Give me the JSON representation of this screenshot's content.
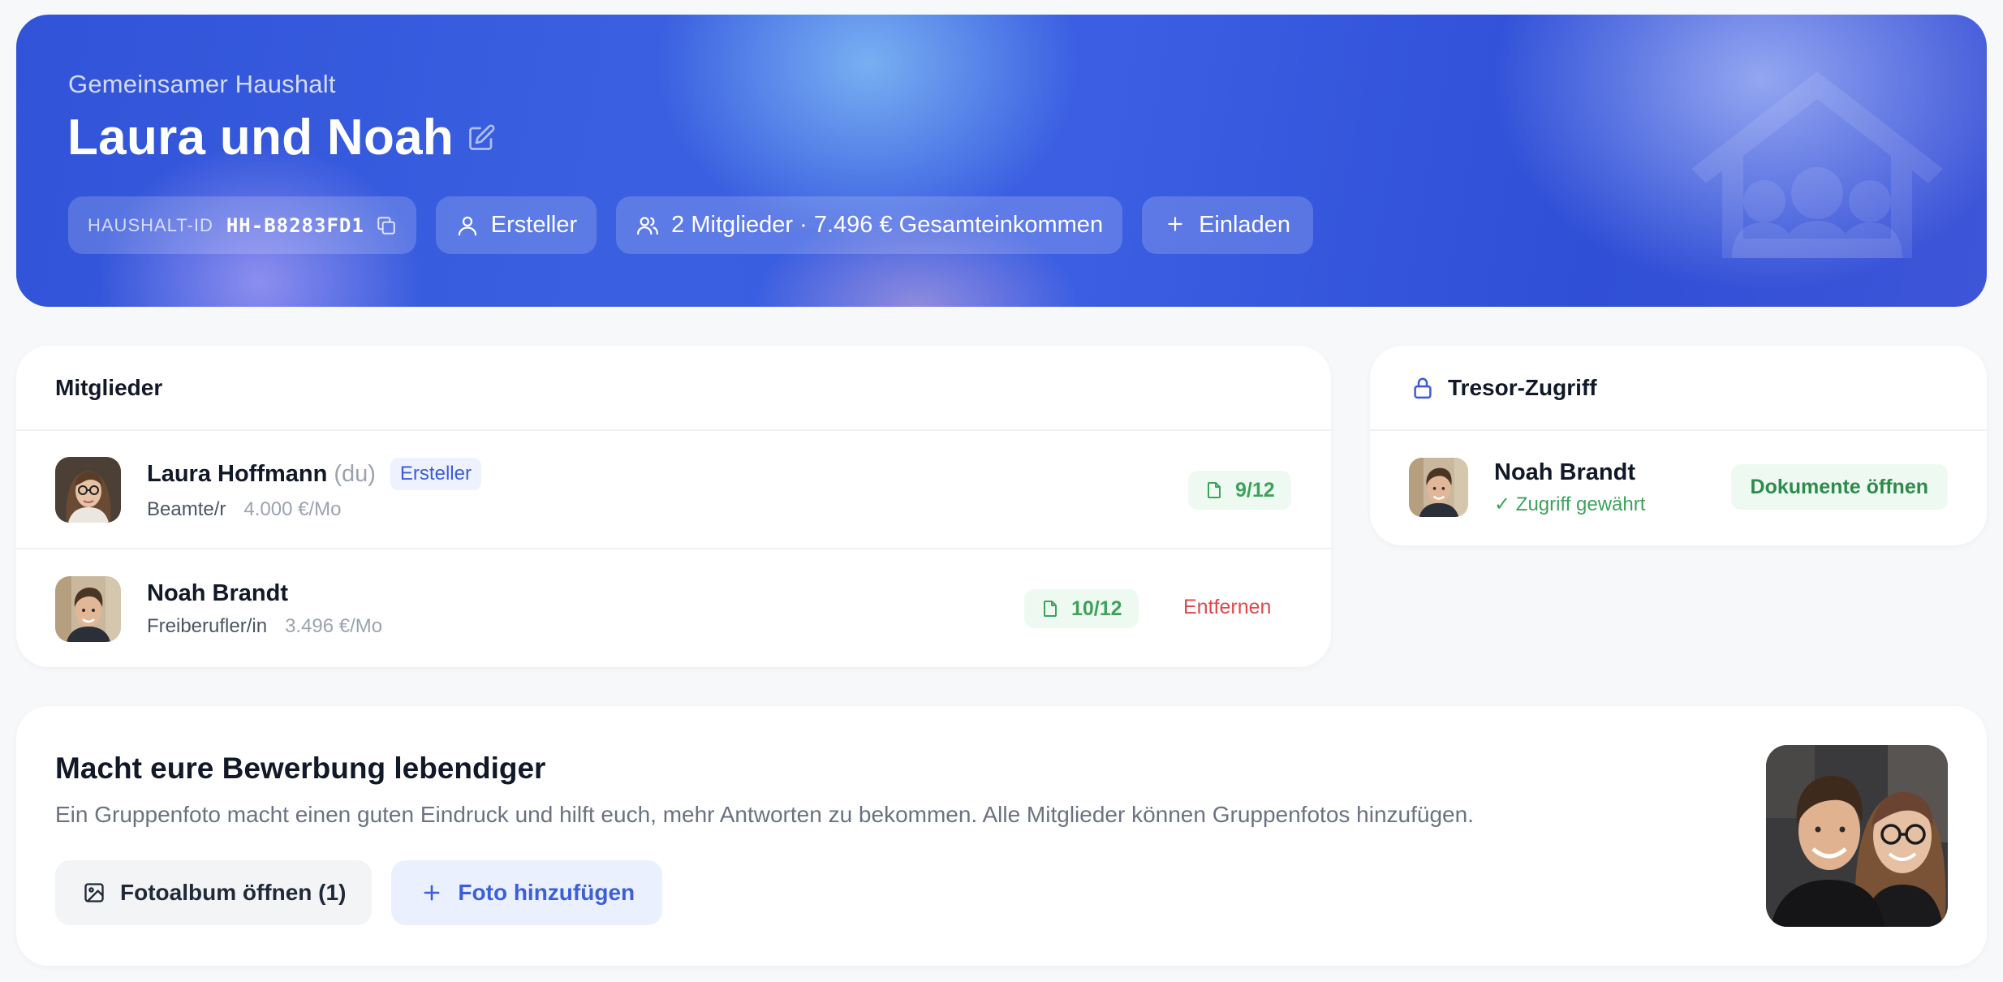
{
  "header": {
    "subtitle": "Gemeinsamer Haushalt",
    "title": "Laura und Noah",
    "household_id_label": "HAUSHALT-ID",
    "household_id": "HH-B8283FD1",
    "role": "Ersteller",
    "members_summary": "2 Mitglieder · 7.496 € Gesamteinkommen",
    "invite_label": "Einladen"
  },
  "members": {
    "heading": "Mitglieder",
    "items": [
      {
        "name": "Laura Hoffmann",
        "you_tag": "(du)",
        "badge": "Ersteller",
        "occupation": "Beamte/r",
        "income": "4.000 €/Mo",
        "documents": "9/12"
      },
      {
        "name": "Noah Brandt",
        "occupation": "Freiberufler/in",
        "income": "3.496 €/Mo",
        "documents": "10/12",
        "remove_label": "Entfernen"
      }
    ]
  },
  "vault": {
    "heading": "Tresor-Zugriff",
    "member_name": "Noah Brandt",
    "access_status": "✓ Zugriff gewährt",
    "open_documents_label": "Dokumente öffnen"
  },
  "promo": {
    "title": "Macht eure Bewerbung lebendiger",
    "text": "Ein Gruppenfoto macht einen guten Eindruck und hilft euch, mehr Antworten zu bekommen. Alle Mitglieder können Gruppenfotos hinzufügen.",
    "album_button": "Fotoalbum öffnen (1)",
    "add_photo_button": "Foto hinzufügen"
  },
  "colors": {
    "accent_blue": "#3b5bdb",
    "success_green": "#3ea25c",
    "danger_red": "#e04848",
    "hero_blue": "#3153d8"
  },
  "icons": {
    "edit": "pencil-square-icon",
    "copy": "copy-icon",
    "user": "user-icon",
    "users": "users-icon",
    "plus": "plus-icon",
    "document": "document-icon",
    "lock": "lock-icon",
    "image": "image-icon",
    "watermark": "house-family-icon"
  }
}
